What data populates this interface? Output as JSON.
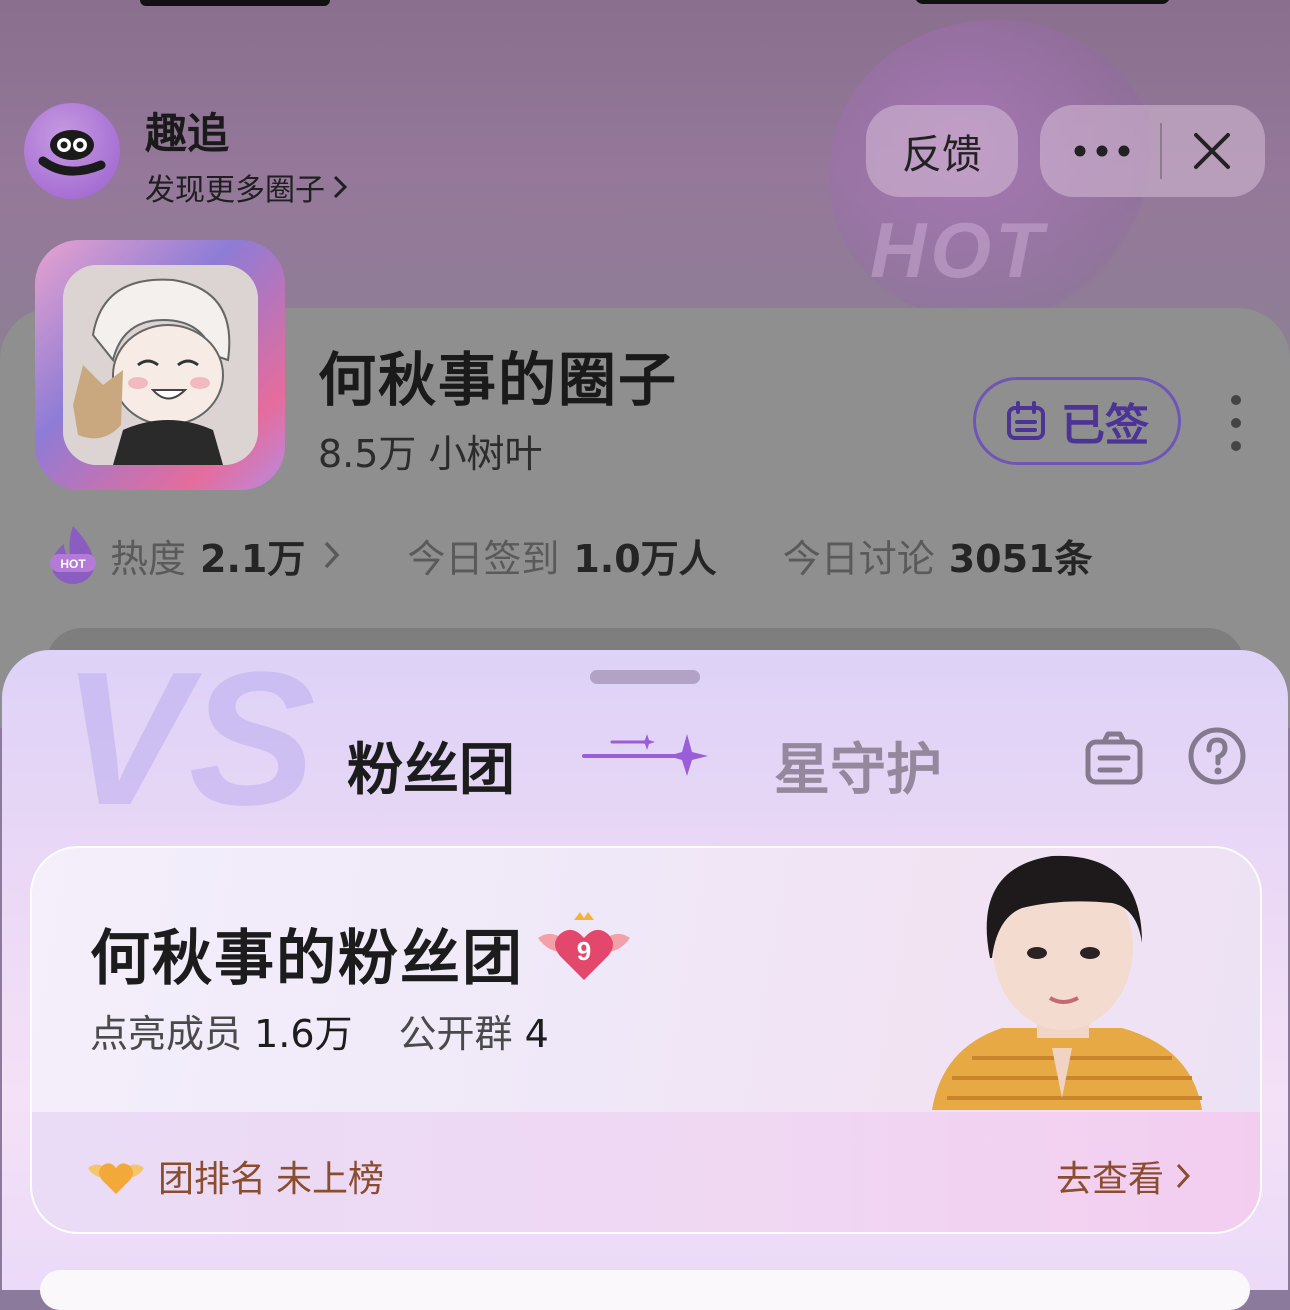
{
  "app": {
    "name": "趣追",
    "subtitle": "发现更多圈子",
    "feedback_label": "反馈"
  },
  "circle": {
    "title": "何秋事的圈子",
    "members": "8.5万",
    "member_unit": "小树叶",
    "signed_label": "已签",
    "stats": [
      {
        "label": "热度",
        "value": "2.1万"
      },
      {
        "label": "今日签到",
        "value": "1.0万人"
      },
      {
        "label": "今日讨论",
        "value": "3051条"
      }
    ]
  },
  "sheet": {
    "tab_active": "粉丝团",
    "tab_inactive": "星守护",
    "fan_club": {
      "title": "何秋事的粉丝团",
      "level": "9",
      "lit_label": "点亮成员",
      "lit_value": "1.6万",
      "group_label": "公开群",
      "group_value": "4",
      "rank_label": "团排名",
      "rank_value": "未上榜",
      "view_label": "去查看"
    }
  },
  "colors": {
    "accent_purple": "#6d56b6",
    "rank_brown": "#8a4d2f"
  }
}
